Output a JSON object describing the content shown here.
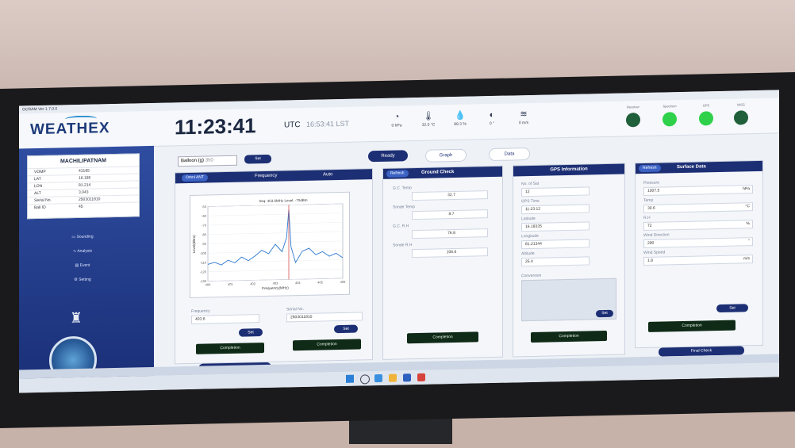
{
  "window": {
    "title": "GCRAM Ver 1.7.0.0"
  },
  "header": {
    "brand": "WEATHEX",
    "time": "11:23:41",
    "utc": "UTC",
    "lst": "16:53:41 LST",
    "metrics": [
      {
        "icon": "gauge-icon",
        "value": "0 hPa"
      },
      {
        "icon": "thermometer-icon",
        "value": "32.0 °C"
      },
      {
        "icon": "humidity-icon",
        "value": "89.3 %"
      },
      {
        "icon": "compass-icon",
        "value": "0 °"
      },
      {
        "icon": "wind-icon",
        "value": "0 m/s"
      }
    ],
    "leds": [
      {
        "label": "Receiver",
        "color": "#1f5f3a"
      },
      {
        "label": "Spectrum",
        "color": "#2fd14a"
      },
      {
        "label": "GPS",
        "color": "#2fd14a"
      },
      {
        "label": "INSG",
        "color": "#1f5f3a"
      }
    ]
  },
  "station": {
    "name": "MACHILIPATNAM",
    "rows": [
      {
        "k": "VOMP",
        "v": "43185"
      },
      {
        "k": "LAT",
        "v": "16.185"
      },
      {
        "k": "LON",
        "v": "81.214"
      },
      {
        "k": "ALT",
        "v": "3.043"
      },
      {
        "k": "Serial No.",
        "v": "2503011810"
      },
      {
        "k": "Ball ID",
        "v": "45"
      }
    ]
  },
  "nav": {
    "sounding": "Sounding",
    "analysis": "Analysis",
    "event": "Event",
    "setting": "Setting"
  },
  "controls": {
    "balloon": "Balloon (g)",
    "balloon_value": "350",
    "set": "Set",
    "ready": "Ready",
    "graph": "Graph",
    "data": "Data"
  },
  "frequency_panel": {
    "tab": "Omni ANT",
    "title": "Frequency",
    "auto": "Auto",
    "chart_title": "freq: 403.6MHz   Level: -70dBm",
    "frequency_label": "Frequency",
    "frequency_value": "403.6",
    "serial_label": "Serial No.",
    "serial_value": "2503011810",
    "set": "Set",
    "completion": "Completion",
    "continue": "Sounding Continue"
  },
  "chart_data": {
    "type": "line",
    "title": "freq: 403.6MHz   Level: -70dBm",
    "xlabel": "Frequency(MHz)",
    "ylabel": "Level(dBm)",
    "x_ticks": [
      "400",
      "401",
      "402",
      "403",
      "404",
      "405",
      "406"
    ],
    "y_ticks": [
      "-50",
      "-60",
      "-70",
      "-80",
      "-90",
      "-100",
      "-110",
      "-120",
      "-130"
    ],
    "xlim": [
      400,
      406
    ],
    "ylim": [
      -130,
      -50
    ],
    "series": [
      {
        "x": [
          400,
          400.3,
          400.6,
          400.9,
          401.2,
          401.5,
          401.8,
          402.1,
          402.4,
          402.7,
          403.0,
          403.3,
          403.5,
          403.6,
          403.7,
          403.9,
          404.2,
          404.5,
          404.8,
          405.1,
          405.4,
          405.7,
          406
        ],
        "y": [
          -112,
          -110,
          -113,
          -108,
          -111,
          -105,
          -109,
          -104,
          -98,
          -102,
          -92,
          -100,
          -85,
          -55,
          -95,
          -112,
          -100,
          -97,
          -104,
          -101,
          -106,
          -103,
          -108
        ]
      }
    ]
  },
  "ground_check": {
    "refresh": "Refresh",
    "title": "Ground Check",
    "fields": [
      {
        "label": "G.C. Temp",
        "value": "32.7"
      },
      {
        "label": "Sonde Temp",
        "value": "8.7"
      },
      {
        "label": "G.C. R.H",
        "value": "76.8"
      },
      {
        "label": "Sonde R.H",
        "value": "106.6"
      }
    ],
    "completion": "Completion"
  },
  "gps": {
    "title": "GPS Information",
    "fields": [
      {
        "label": "No. of Sat",
        "value": "12"
      },
      {
        "label": "GPS Time",
        "value": "11:23:12"
      },
      {
        "label": "Latitude",
        "value": "16.18335"
      },
      {
        "label": "Longitude",
        "value": "81.21344"
      },
      {
        "label": "Altitude",
        "value": "25.4"
      }
    ],
    "offset_label": "Conversion",
    "set": "Set",
    "completion": "Completion"
  },
  "surface": {
    "refresh": "Refresh",
    "title": "Surface Data",
    "fields": [
      {
        "label": "Pressure",
        "value": "1007.5",
        "unit": "hPa"
      },
      {
        "label": "Temp",
        "value": "30.6",
        "unit": "°C"
      },
      {
        "label": "R.H",
        "value": "72",
        "unit": "%"
      },
      {
        "label": "Wind Direction",
        "value": "290",
        "unit": "°"
      },
      {
        "label": "Wind Speed",
        "value": "1.8",
        "unit": "m/s"
      }
    ],
    "set": "Set",
    "completion": "Completion",
    "final_check": "Final Check"
  }
}
